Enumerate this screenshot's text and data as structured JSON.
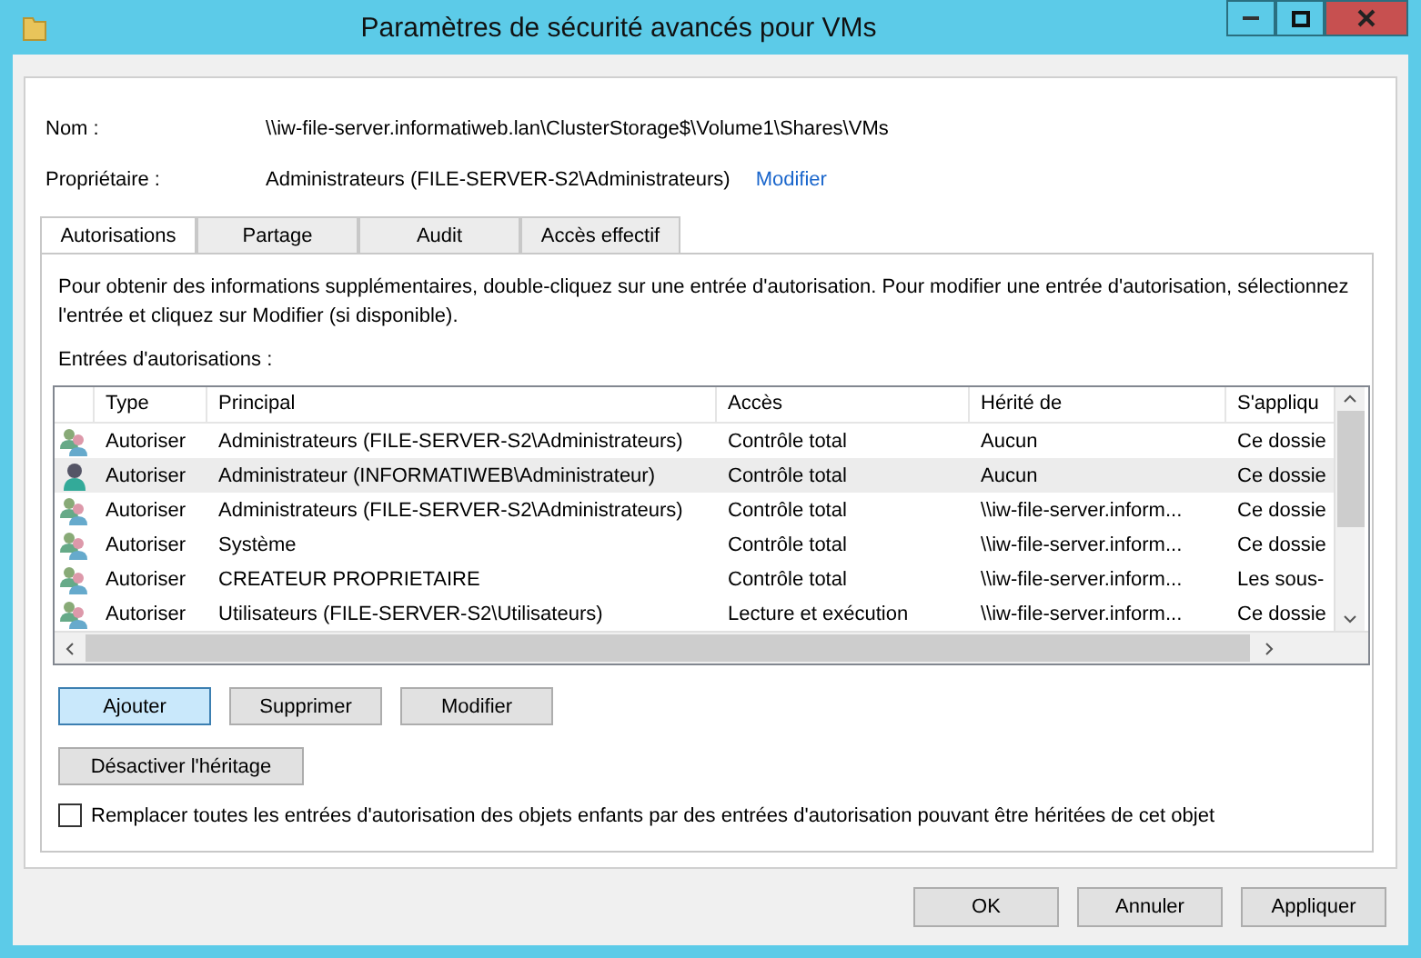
{
  "window": {
    "title": "Paramètres de sécurité avancés pour VMs"
  },
  "name": {
    "label": "Nom :",
    "value": "\\\\iw-file-server.informatiweb.lan\\ClusterStorage$\\Volume1\\Shares\\VMs"
  },
  "owner": {
    "label": "Propriétaire :",
    "value": "Administrateurs (FILE-SERVER-S2\\Administrateurs)",
    "link": "Modifier"
  },
  "tabs": [
    {
      "label": "Autorisations",
      "selected": true
    },
    {
      "label": "Partage",
      "selected": false
    },
    {
      "label": "Audit",
      "selected": false
    },
    {
      "label": "Accès effectif",
      "selected": false
    }
  ],
  "info": "Pour obtenir des informations supplémentaires, double-cliquez sur une entrée d'autorisation. Pour modifier une entrée d'autorisation, sélectionnez l'entrée et cliquez sur Modifier (si disponible).",
  "entries_label": "Entrées d'autorisations :",
  "table": {
    "columns": [
      "Type",
      "Principal",
      "Accès",
      "Hérité de",
      "S'appliqu"
    ],
    "rows": [
      {
        "kind": "group",
        "selected": false,
        "cells": [
          "Autoriser",
          "Administrateurs (FILE-SERVER-S2\\Administrateurs)",
          "Contrôle total",
          "Aucun",
          "Ce dossie"
        ]
      },
      {
        "kind": "user",
        "selected": true,
        "cells": [
          "Autoriser",
          "Administrateur (INFORMATIWEB\\Administrateur)",
          "Contrôle total",
          "Aucun",
          "Ce dossie"
        ]
      },
      {
        "kind": "group",
        "selected": false,
        "cells": [
          "Autoriser",
          "Administrateurs (FILE-SERVER-S2\\Administrateurs)",
          "Contrôle total",
          "\\\\iw-file-server.inform...",
          "Ce dossie"
        ]
      },
      {
        "kind": "group",
        "selected": false,
        "cells": [
          "Autoriser",
          "Système",
          "Contrôle total",
          "\\\\iw-file-server.inform...",
          "Ce dossie"
        ]
      },
      {
        "kind": "group",
        "selected": false,
        "cells": [
          "Autoriser",
          "CREATEUR PROPRIETAIRE",
          "Contrôle total",
          "\\\\iw-file-server.inform...",
          "Les sous-"
        ]
      },
      {
        "kind": "group",
        "selected": false,
        "cells": [
          "Autoriser",
          "Utilisateurs (FILE-SERVER-S2\\Utilisateurs)",
          "Lecture et exécution",
          "\\\\iw-file-server.inform...",
          "Ce dossie"
        ]
      }
    ]
  },
  "entry_buttons": [
    {
      "label": "Ajouter",
      "focused": true
    },
    {
      "label": "Supprimer",
      "focused": false
    },
    {
      "label": "Modifier",
      "focused": false
    }
  ],
  "inheritance_button": "Désactiver l'héritage",
  "replace_checkbox": {
    "label": "Remplacer toutes les entrées d'autorisation des objets enfants par des entrées d'autorisation pouvant être héritées de cet objet",
    "checked": false
  },
  "dialog_buttons": [
    "OK",
    "Annuler",
    "Appliquer"
  ]
}
